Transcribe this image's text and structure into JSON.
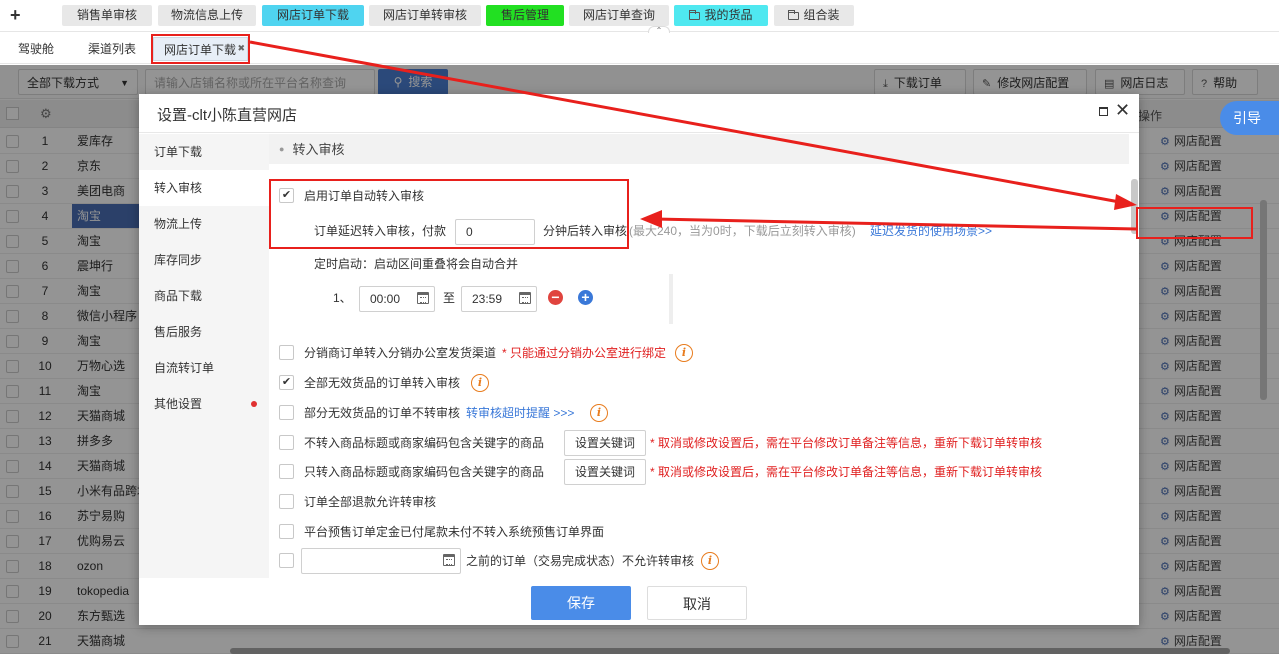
{
  "top_tabs": [
    {
      "label": "销售单审核",
      "bg": "#e8e8e8"
    },
    {
      "label": "物流信息上传",
      "bg": "#e8e8e8"
    },
    {
      "label": "网店订单下载",
      "bg": "#4fd4f0"
    },
    {
      "label": "网店订单转审核",
      "bg": "#e8e8e8"
    },
    {
      "label": "售后管理",
      "bg": "#22e022"
    },
    {
      "label": "网店订单查询",
      "bg": "#e8e8e8"
    },
    {
      "label": "我的货品",
      "bg": "#4fe8f0"
    },
    {
      "label": "组合装",
      "bg": "#e8e8e8"
    }
  ],
  "sub_tabs": [
    "驾驶舱",
    "渠道列表",
    "网店订单下载"
  ],
  "toolbar": {
    "download_mode": "全部下载方式",
    "search_placeholder": "请输入店铺名称或所在平台名称查询",
    "search_label": "搜索",
    "download_orders": "下载订单",
    "modify_config": "修改网店配置",
    "shop_log": "网店日志",
    "help": "帮助"
  },
  "table": {
    "op_header": "操作",
    "config_label": "网店配置",
    "rows": [
      {
        "n": "1",
        "name": "爱库存"
      },
      {
        "n": "2",
        "name": "京东"
      },
      {
        "n": "3",
        "name": "美团电商"
      },
      {
        "n": "4",
        "name": "淘宝"
      },
      {
        "n": "5",
        "name": "淘宝"
      },
      {
        "n": "6",
        "name": "震坤行"
      },
      {
        "n": "7",
        "name": "淘宝"
      },
      {
        "n": "8",
        "name": "微信小程序"
      },
      {
        "n": "9",
        "name": "淘宝"
      },
      {
        "n": "10",
        "name": "万物心选"
      },
      {
        "n": "11",
        "name": "淘宝"
      },
      {
        "n": "12",
        "name": "天猫商城"
      },
      {
        "n": "13",
        "name": "拼多多"
      },
      {
        "n": "14",
        "name": "天猫商城"
      },
      {
        "n": "15",
        "name": "小米有品跨境"
      },
      {
        "n": "16",
        "name": "苏宁易购"
      },
      {
        "n": "17",
        "name": "优购易云"
      },
      {
        "n": "18",
        "name": "ozon"
      },
      {
        "n": "19",
        "name": "tokopedia"
      },
      {
        "n": "20",
        "name": "东方甄选"
      },
      {
        "n": "21",
        "name": "天猫商城"
      }
    ]
  },
  "guide_label": "引导",
  "dialog": {
    "title": "设置-clt小陈直营网店",
    "nav": [
      "订单下载",
      "转入审核",
      "物流上传",
      "库存同步",
      "商品下载",
      "售后服务",
      "自流转订单",
      "其他设置"
    ],
    "section_title": "转入审核",
    "auto_label": "启用订单自动转入审核",
    "delay_label": "订单延迟转入审核，付款",
    "delay_value": "0",
    "delay_suffix": "分钟后转入审核",
    "delay_hint": "(最大240，当为0时，下载后立刻转入审核)",
    "delay_link": "延迟发货的使用场景>>",
    "timer_label": "定时启动：启动区间重叠将会自动合并",
    "timer_index": "1、",
    "time_from": "00:00",
    "time_to_label": "至",
    "time_to": "23:59",
    "opt1": "分销商订单转入分销办公室发货渠道",
    "opt1_note": "* 只能通过分销办公室进行绑定",
    "opt2": "全部无效货品的订单转入审核",
    "opt3": "部分无效货品的订单不转审核",
    "opt3_link": "转审核超时提醒 >>>",
    "opt4": "不转入商品标题或商家编码包含关键字的商品",
    "opt5": "只转入商品标题或商家编码包含关键字的商品",
    "keyword_btn": "设置关键词",
    "keyword_note": "* 取消或修改设置后，需在平台修改订单备注等信息，重新下载订单转审核",
    "opt6": "订单全部退款允许转审核",
    "opt7": "平台预售订单定金已付尾款未付不转入系统预售订单界面",
    "opt8_suffix": "之前的订单（交易完成状态）不允许转审核",
    "save": "保存",
    "cancel": "取消"
  },
  "colors": {
    "accent": "#4a8ce8",
    "annotation": "#e8201c",
    "selected_row": "#4a6fb5"
  }
}
